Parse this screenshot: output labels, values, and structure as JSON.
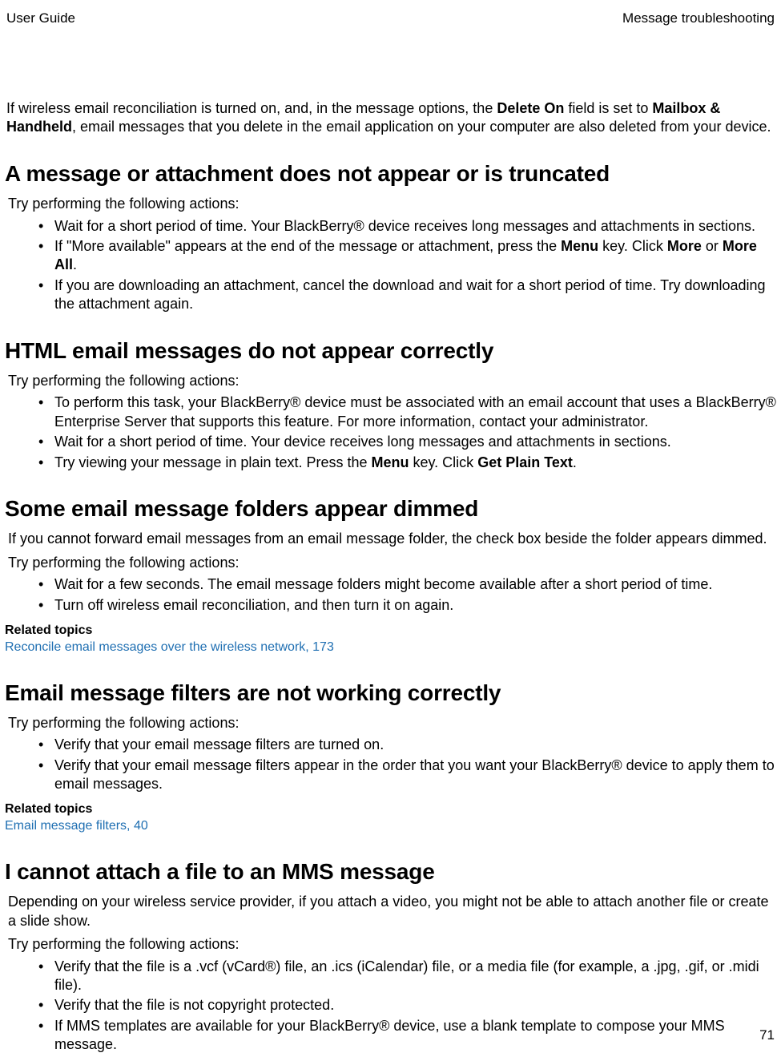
{
  "header": {
    "left": "User Guide",
    "right": "Message troubleshooting"
  },
  "intro": {
    "pre": "If wireless email reconciliation is turned on, and, in the message options, the ",
    "bold1": "Delete On",
    "mid1": " field is set to ",
    "bold2": "Mailbox & Handheld",
    "post": ", email messages that you delete in the email application on your computer are also deleted from your device."
  },
  "sections": {
    "s1": {
      "title": "A message or attachment does not appear or is truncated",
      "lead": "Try performing the following actions:",
      "b1": "Wait for a short period of time. Your BlackBerry® device receives long messages and attachments in sections.",
      "b2_pre": "If \"More available\" appears at the end of the message or attachment, press the ",
      "b2_bold1": "Menu",
      "b2_mid1": " key. Click ",
      "b2_bold2": "More",
      "b2_mid2": " or ",
      "b2_bold3": "More All",
      "b2_post": ".",
      "b3": "If you are downloading an attachment, cancel the download and wait for a short period of time. Try downloading the attachment again."
    },
    "s2": {
      "title": "HTML email messages do not appear correctly",
      "lead": "Try performing the following actions:",
      "b1": "To perform this task, your BlackBerry® device must be associated with an email account that uses a BlackBerry® Enterprise Server that supports this feature. For more information, contact your administrator.",
      "b2": "Wait for a short period of time. Your device receives long messages and attachments in sections.",
      "b3_pre": "Try viewing your message in plain text. Press the ",
      "b3_bold1": "Menu",
      "b3_mid1": " key. Click ",
      "b3_bold2": "Get Plain Text",
      "b3_post": "."
    },
    "s3": {
      "title": "Some email message folders appear dimmed",
      "p1": "If you cannot forward email messages from an email message folder, the check box beside the folder appears dimmed.",
      "lead": "Try performing the following actions:",
      "b1": "Wait for a few seconds. The email message folders might become available after a short period of time.",
      "b2": "Turn off wireless email reconciliation, and then turn it on again.",
      "related_heading": "Related topics",
      "related_link": "Reconcile email messages over the wireless network, 173"
    },
    "s4": {
      "title": "Email message filters are not working correctly",
      "lead": "Try performing the following actions:",
      "b1": "Verify that your email message filters are turned on.",
      "b2": "Verify that your email message filters appear in the order that you want your BlackBerry® device to apply them to email messages.",
      "related_heading": "Related topics",
      "related_link": "Email message filters, 40"
    },
    "s5": {
      "title": "I cannot attach a file to an MMS message",
      "p1": "Depending on your wireless service provider, if you attach a video, you might not be able to attach another file or create a slide show.",
      "lead": "Try performing the following actions:",
      "b1": "Verify that the file is a .vcf (vCard®) file, an .ics (iCalendar) file, or a media file (for example, a .jpg, .gif, or .midi file).",
      "b2": "Verify that the file is not copyright protected.",
      "b3": "If MMS templates are available for your BlackBerry® device, use a blank template to compose your MMS message."
    }
  },
  "page_number": "71"
}
